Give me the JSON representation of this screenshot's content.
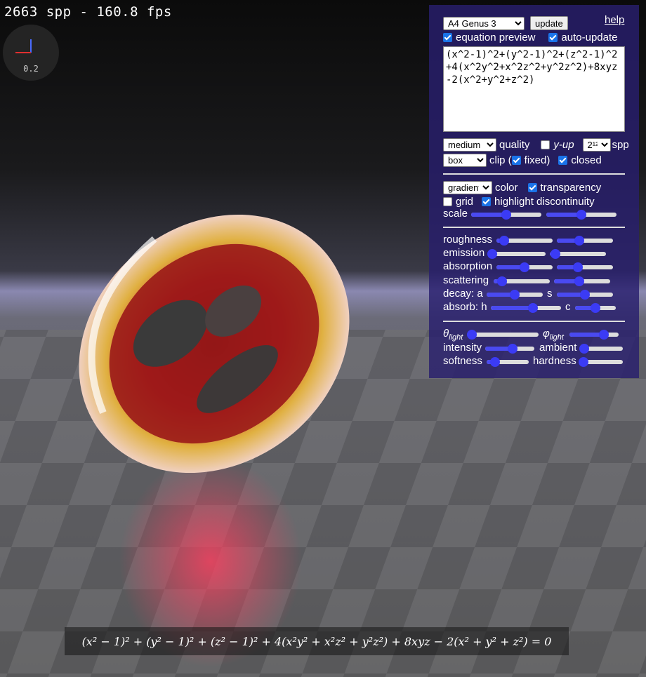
{
  "status": {
    "fps_text": "2663 spp - 160.8 fps"
  },
  "gizmo": {
    "scale_label": "0.2"
  },
  "panel": {
    "preset": "A4 Genus 3",
    "update_label": "update",
    "help_label": "help",
    "equation_preview_label": "equation preview",
    "equation_preview": true,
    "auto_update_label": "auto-update",
    "auto_update": true,
    "equation": "(x^2-1)^2+(y^2-1)^2+(z^2-1)^2+4(x^2y^2+x^2z^2+y^2z^2)+8xyz-2(x^2+y^2+z^2)",
    "quality": "medium",
    "quality_label": "quality",
    "y_up_label": "y-up",
    "y_up": false,
    "spp": "2¹²",
    "spp_label": "spp",
    "clip": "box",
    "clip_label": "clip (",
    "fixed_label": "fixed)",
    "fixed": true,
    "closed_label": "closed",
    "closed": true,
    "color_mode": "gradient",
    "color_label": "color",
    "transparency_label": "transparency",
    "transparency": true,
    "grid_label": "grid",
    "grid": false,
    "highlight_label": "highlight discontinuity",
    "highlight": true,
    "scale_label": "scale",
    "roughness_label": "roughness",
    "emission_label": "emission",
    "absorption_label": "absorption",
    "scattering_label": "scattering",
    "decay_a_label": "decay: a",
    "decay_s_label": "s",
    "absorb_h_label": "absorb: h",
    "absorb_c_label": "c",
    "theta_label": "θ",
    "theta_sub": "light",
    "phi_label": "φ",
    "phi_sub": "light",
    "intensity_label": "intensity",
    "ambient_label": "ambient",
    "softness_label": "softness",
    "hardness_label": "hardness",
    "sliders": {
      "scale_1": 0.5,
      "scale_2": 0.5,
      "roughness_1": 0.14,
      "roughness_2": 0.4,
      "emission_1": 0.05,
      "emission_2": 0.1,
      "absorption_1": 0.5,
      "absorption_2": 0.38,
      "scattering_1": 0.15,
      "scattering_2": 0.45,
      "decay_a": 0.5,
      "decay_s": 0.5,
      "absorb_h": 0.6,
      "absorb_c": 0.5,
      "theta_light": 0.05,
      "phi_light": 0.7,
      "intensity": 0.55,
      "ambient": 0.08,
      "softness": 0.2,
      "hardness": 0.07
    }
  },
  "latex_equation": "(x² − 1)² + (y² − 1)² + (z² − 1)² + 4(x²y² + x²z² + y²z²) + 8xyz − 2(x² + y² + z²) = 0"
}
